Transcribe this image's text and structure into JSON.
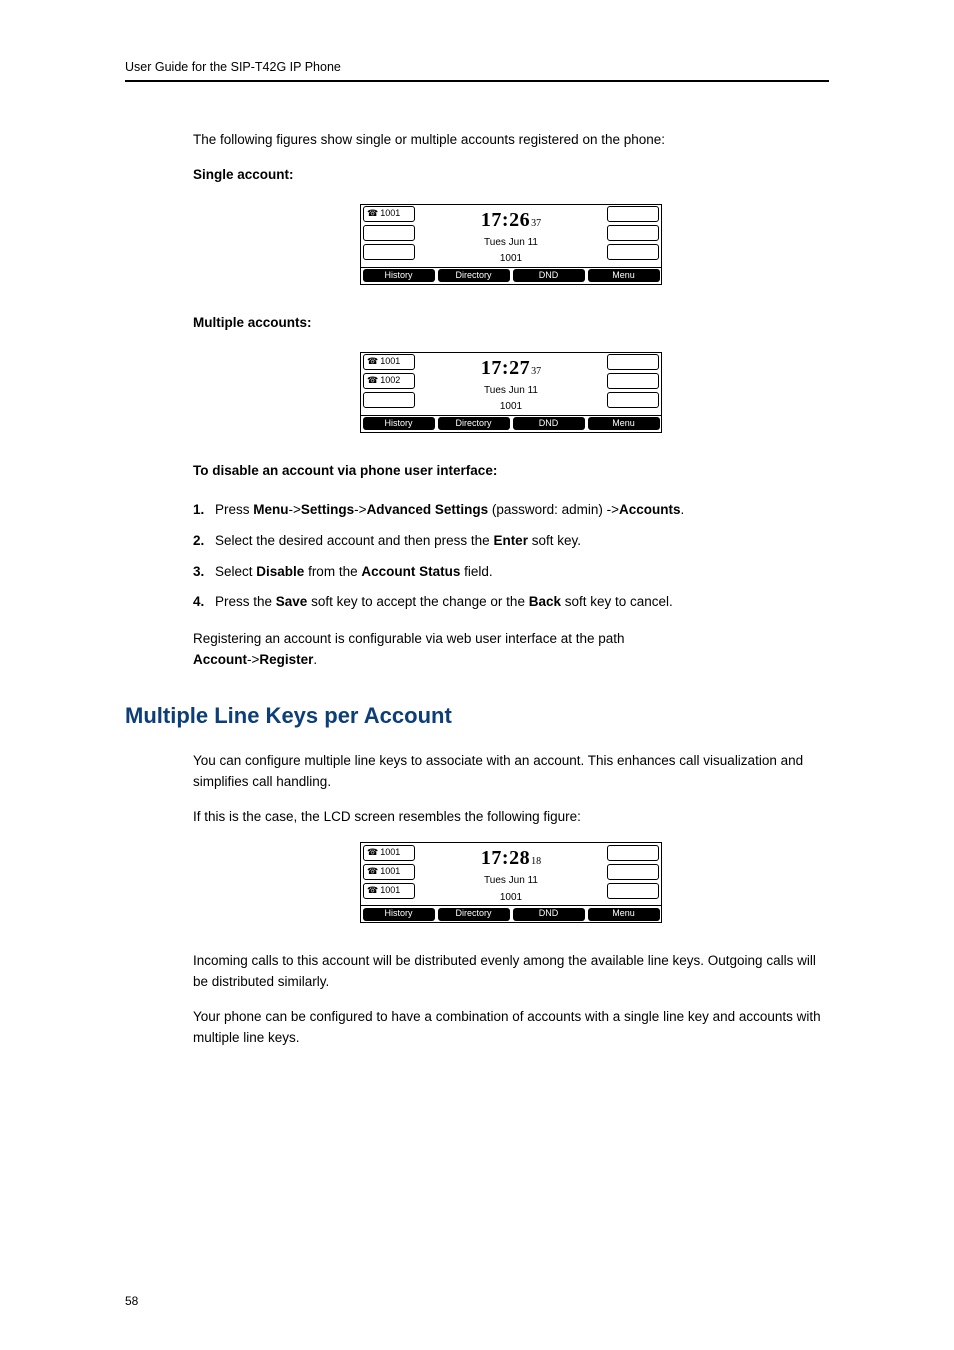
{
  "header": {
    "title": "User Guide for the SIP-T42G IP Phone"
  },
  "page_number": "58",
  "intro_para": "The following figures show single or multiple accounts registered on the phone:",
  "single_label": "Single account:",
  "multiple_label": "Multiple accounts:",
  "disable_heading": "To disable an account via phone user interface:",
  "steps": [
    {
      "n": "1.",
      "pre": "Press ",
      "b1": "Menu",
      "mid1": "->",
      "b2": "Settings",
      "mid2": "->",
      "b3": "Advanced Settings",
      "post1": " (password: admin) ->",
      "b4": "Accounts",
      "post2": "."
    },
    {
      "n": "2.",
      "pre": "Select the desired account and then press the ",
      "b1": "Enter",
      "post1": " soft key."
    },
    {
      "n": "3.",
      "pre": "Select ",
      "b1": "Disable",
      "mid1": " from the ",
      "b2": "Account Status",
      "post1": " field."
    },
    {
      "n": "4.",
      "pre": "Press the ",
      "b1": "Save",
      "mid1": " soft key to accept the change or the ",
      "b2": "Back",
      "post1": " soft key to cancel."
    }
  ],
  "register_para_text": "Registering an account is configurable via web user interface at the path ",
  "register_path_1": "Account",
  "register_path_sep": "->",
  "register_path_2": "Register",
  "register_path_end": ".",
  "section_heading": "Multiple Line Keys per Account",
  "mlk_para1": "You can configure multiple line keys to associate with an account. This enhances call visualization and simplifies call handling.",
  "mlk_para2": "If this is the case, the LCD screen resembles the following figure:",
  "mlk_para3": "Incoming calls to this account will be distributed evenly among the available line keys. Outgoing calls will be distributed similarly.",
  "mlk_para4": "Your phone can be configured to have a combination of accounts with a single line key and accounts with multiple line keys.",
  "softkeys": {
    "history": "History",
    "directory": "Directory",
    "dnd": "DND",
    "menu": "Menu"
  },
  "phone_icon": "☎",
  "chart_data": [
    {
      "type": "table",
      "id": "single-account-display",
      "time": "17:26",
      "seconds": "37",
      "date": "Tues Jun 11",
      "extension": "1001",
      "left_linekeys": [
        "1001",
        "",
        ""
      ],
      "right_linekeys": [
        "",
        "",
        ""
      ],
      "softkeys": [
        "History",
        "Directory",
        "DND",
        "Menu"
      ]
    },
    {
      "type": "table",
      "id": "multiple-accounts-display",
      "time": "17:27",
      "seconds": "37",
      "date": "Tues Jun 11",
      "extension": "1001",
      "left_linekeys": [
        "1001",
        "1002",
        ""
      ],
      "right_linekeys": [
        "",
        "",
        ""
      ],
      "softkeys": [
        "History",
        "Directory",
        "DND",
        "Menu"
      ]
    },
    {
      "type": "table",
      "id": "multiple-linekeys-display",
      "time": "17:28",
      "seconds": "18",
      "date": "Tues Jun 11",
      "extension": "1001",
      "left_linekeys": [
        "1001",
        "1001",
        "1001"
      ],
      "right_linekeys": [
        "",
        "",
        ""
      ],
      "softkeys": [
        "History",
        "Directory",
        "DND",
        "Menu"
      ]
    }
  ]
}
